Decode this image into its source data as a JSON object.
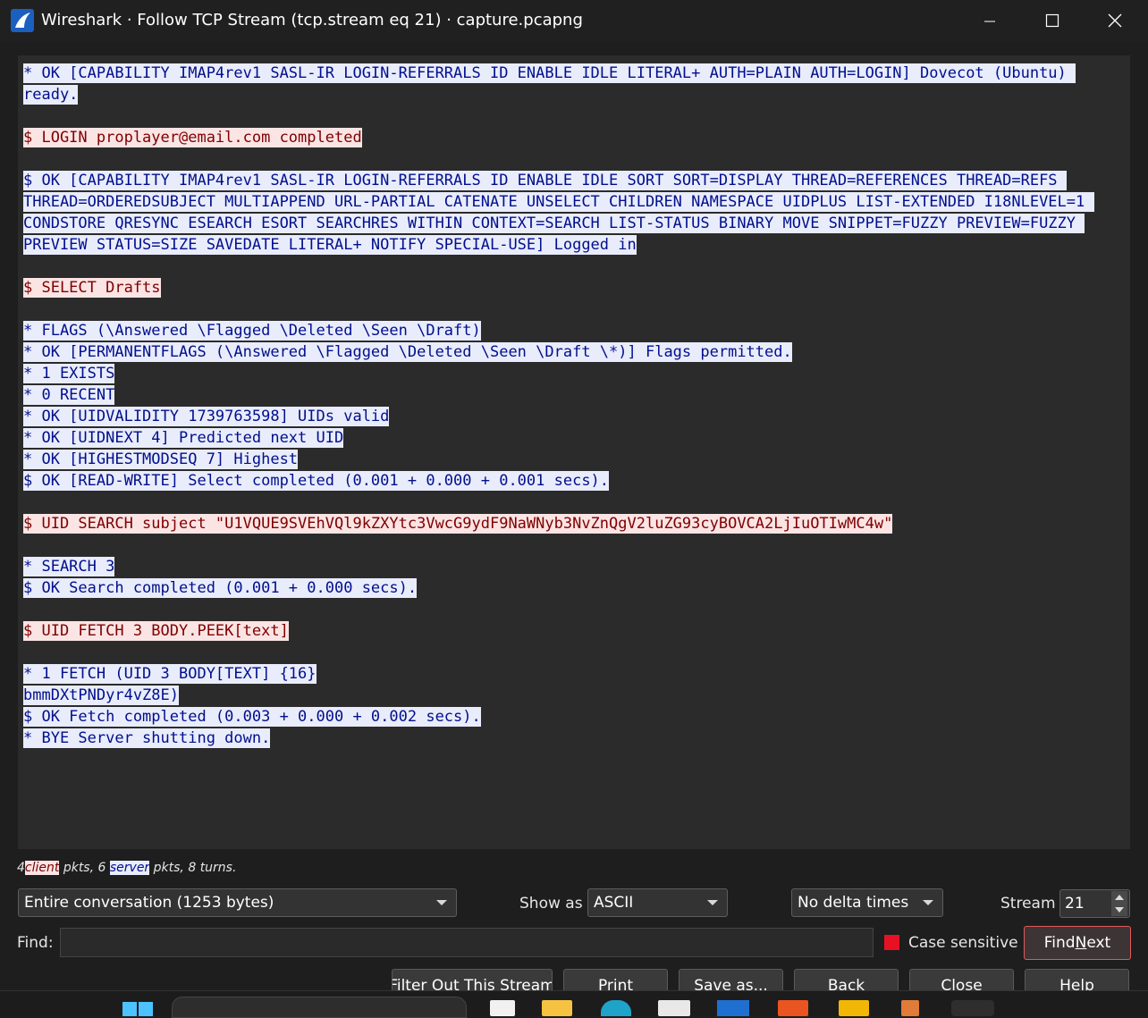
{
  "window": {
    "title": "Wireshark · Follow TCP Stream (tcp.stream eq 21) · capture.pcapng",
    "controls": [
      "minimize-icon",
      "maximize-icon",
      "close-icon"
    ]
  },
  "stream": {
    "segments": [
      {
        "dir": "server",
        "text": "* OK [CAPABILITY IMAP4rev1 SASL-IR LOGIN-REFERRALS ID ENABLE IDLE LITERAL+ AUTH=PLAIN AUTH=LOGIN] Dovecot (Ubuntu) ready."
      },
      {
        "dir": "client",
        "text": "$ LOGIN proplayer@email.com completed"
      },
      {
        "dir": "server",
        "text": "$ OK [CAPABILITY IMAP4rev1 SASL-IR LOGIN-REFERRALS ID ENABLE IDLE SORT SORT=DISPLAY THREAD=REFERENCES THREAD=REFS THREAD=ORDEREDSUBJECT MULTIAPPEND URL-PARTIAL CATENATE UNSELECT CHILDREN NAMESPACE UIDPLUS LIST-EXTENDED I18NLEVEL=1 CONDSTORE QRESYNC ESEARCH ESORT SEARCHRES WITHIN CONTEXT=SEARCH LIST-STATUS BINARY MOVE SNIPPET=FUZZY PREVIEW=FUZZY PREVIEW STATUS=SIZE SAVEDATE LITERAL+ NOTIFY SPECIAL-USE] Logged in"
      },
      {
        "dir": "client",
        "text": "$ SELECT Drafts"
      },
      {
        "dir": "server",
        "text": "* FLAGS (\\Answered \\Flagged \\Deleted \\Seen \\Draft)\n* OK [PERMANENTFLAGS (\\Answered \\Flagged \\Deleted \\Seen \\Draft \\*)] Flags permitted.\n* 1 EXISTS\n* 0 RECENT\n* OK [UIDVALIDITY 1739763598] UIDs valid\n* OK [UIDNEXT 4] Predicted next UID\n* OK [HIGHESTMODSEQ 7] Highest\n$ OK [READ-WRITE] Select completed (0.001 + 0.000 + 0.001 secs)."
      },
      {
        "dir": "client",
        "text": "$ UID SEARCH subject \"U1VQUE9SVEhVQl9kZXYtc3VwcG9ydF9NaWNyb3NvZnQgV2luZG93cyBOVCA2LjIuOTIwMC4w\""
      },
      {
        "dir": "server",
        "text": "* SEARCH 3\n$ OK Search completed (0.001 + 0.000 secs)."
      },
      {
        "dir": "client",
        "text": "$ UID FETCH 3 BODY.PEEK[text]"
      },
      {
        "dir": "server",
        "text": "* 1 FETCH (UID 3 BODY[TEXT] {16}\nbmmDXtPNDyr4vZ8E)\n$ OK Fetch completed (0.003 + 0.000 + 0.002 secs).\n* BYE Server shutting down."
      }
    ]
  },
  "stats": {
    "client_count": "4",
    "client_word": "client",
    "sep1": " pkts, 6 ",
    "server_word": "server",
    "tail": " pkts, 8 turns."
  },
  "controls": {
    "conversation": "Entire conversation (1253 bytes)",
    "show_as_label": "Show as",
    "show_as_value": "ASCII",
    "delta": "No delta times",
    "stream_label": "Stream",
    "stream_value": "21",
    "find_label": "Find:",
    "find_value": "",
    "case_sensitive_label": "Case sensitive",
    "find_next_label": "Find Next"
  },
  "buttons": {
    "filter_out": "Filter Out This Stream",
    "print": "Print",
    "save_as": "Save as...",
    "back": "Back",
    "close": "Close",
    "help": "Help"
  },
  "colors": {
    "client_bg": "#fbe4e4",
    "client_fg": "#7e0000",
    "server_bg": "#e9ecfb",
    "server_fg": "#000f8c",
    "checkbox_accent": "#e81123"
  },
  "taskbar": {
    "icons": [
      "windows-start-icon",
      "search-box",
      "file-icon",
      "folder-icon",
      "edge-icon",
      "store-icon",
      "app-icon",
      "ubuntu-icon",
      "paint-icon",
      "pencil-icon",
      "wireshark-icon"
    ]
  }
}
